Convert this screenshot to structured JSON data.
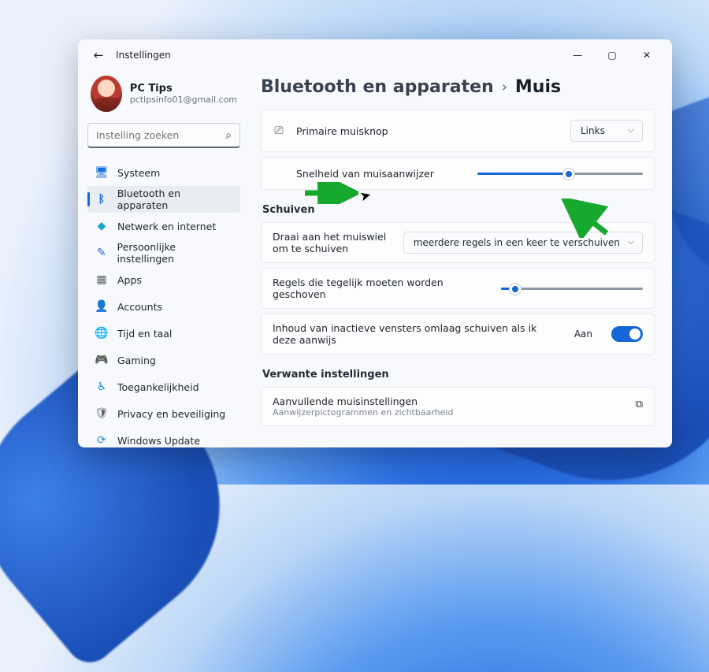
{
  "window": {
    "title": "Instellingen"
  },
  "user": {
    "name": "PC Tips",
    "email": "pctipsinfo01@gmail.com"
  },
  "search": {
    "placeholder": "Instelling zoeken"
  },
  "sidebar": {
    "items": [
      {
        "label": "Systeem",
        "icon": "monitor-icon",
        "color": "#1b6fd8"
      },
      {
        "label": "Bluetooth en apparaten",
        "icon": "bluetooth-icon",
        "color": "#1566d6",
        "active": true
      },
      {
        "label": "Netwerk en internet",
        "icon": "wifi-icon",
        "color": "#17a6c9"
      },
      {
        "label": "Persoonlijke instellingen",
        "icon": "brush-icon",
        "color": "#2e64d6"
      },
      {
        "label": "Apps",
        "icon": "apps-icon",
        "color": "#5a6370"
      },
      {
        "label": "Accounts",
        "icon": "account-icon",
        "color": "#3aa655"
      },
      {
        "label": "Tijd en taal",
        "icon": "globe-time-icon",
        "color": "#3d7fe8"
      },
      {
        "label": "Gaming",
        "icon": "gamepad-icon",
        "color": "#5a6370"
      },
      {
        "label": "Toegankelijkheid",
        "icon": "accessibility-icon",
        "color": "#1b8fd8"
      },
      {
        "label": "Privacy en beveiliging",
        "icon": "shield-icon",
        "color": "#5a6370"
      },
      {
        "label": "Windows Update",
        "icon": "update-icon",
        "color": "#1b8fd8"
      }
    ]
  },
  "breadcrumb": {
    "parent": "Bluetooth en apparaten",
    "current": "Muis"
  },
  "settings": {
    "primary_button": {
      "label": "Primaire muisknop",
      "value": "Links"
    },
    "pointer_speed": {
      "label": "Snelheid van muisaanwijzer",
      "value_pct": 55
    },
    "scroll_section": "Schuiven",
    "scroll_wheel": {
      "label": "Draai aan het muiswiel om te schuiven",
      "value": "meerdere regels in een keer te verschuiven"
    },
    "lines_at_once": {
      "label": "Regels die tegelijk moeten worden geschoven",
      "value_pct": 10
    },
    "inactive_scroll": {
      "label": "Inhoud van inactieve vensters omlaag schuiven als ik deze aanwijs",
      "state_label": "Aan",
      "on": true
    },
    "related_section": "Verwante instellingen",
    "related_link": {
      "title": "Aanvullende muisinstellingen",
      "subtitle": "Aanwijzerpictogrammen en zichtbaarheid"
    }
  },
  "icons": {
    "monitor": "🖥",
    "bluetooth": "ᛒ",
    "wifi": "◆",
    "brush": "✎",
    "apps": "▦",
    "account": "👤",
    "globe": "🌐",
    "game": "🎮",
    "access": "♿",
    "shield": "🛡",
    "update": "⟳",
    "search": "⌕",
    "mouse": "⎚",
    "back": "←",
    "min": "—",
    "max": "▢",
    "close": "✕",
    "open": "⧉",
    "chev": "›"
  }
}
